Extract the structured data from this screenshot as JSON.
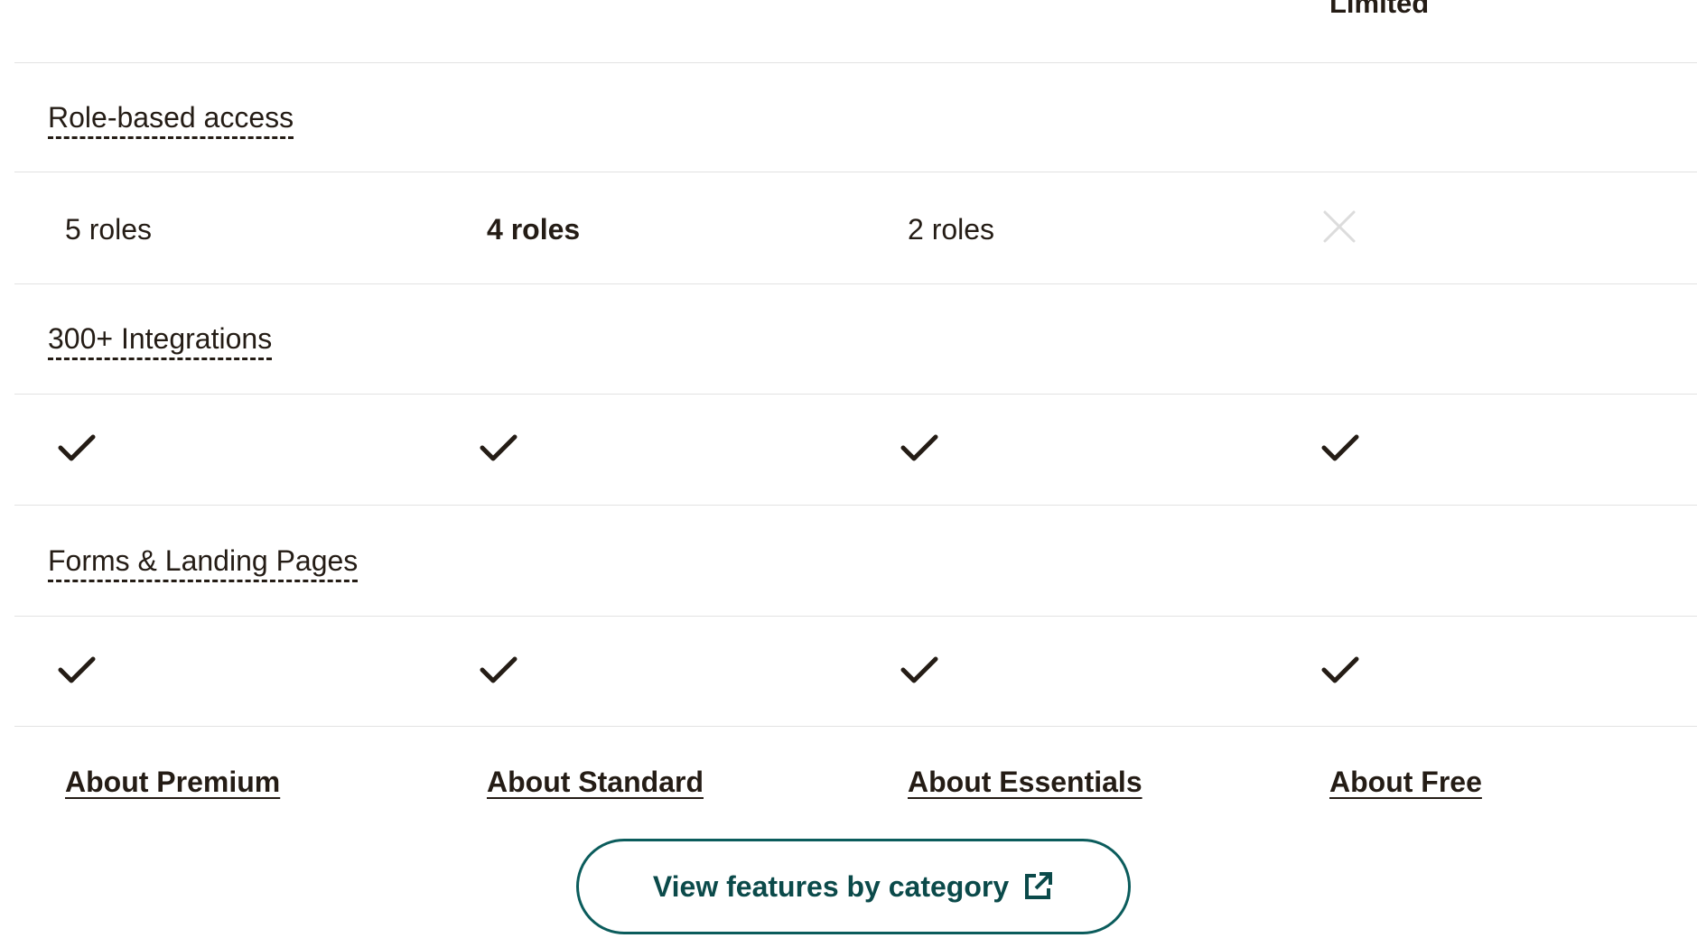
{
  "partial_row": {
    "free_value": "Limited"
  },
  "plans": [
    "Premium",
    "Standard",
    "Essentials",
    "Free"
  ],
  "features": [
    {
      "label": "Role-based access",
      "values": [
        "5 roles",
        "4 roles",
        "2 roles",
        "not-included"
      ]
    },
    {
      "label": "300+ Integrations",
      "values": [
        "included",
        "included",
        "included",
        "included"
      ]
    },
    {
      "label": "Forms & Landing Pages",
      "values": [
        "included",
        "included",
        "included",
        "included"
      ]
    }
  ],
  "about_links": {
    "premium": "About Premium",
    "standard": "About Standard",
    "essentials": "About Essentials",
    "free": "About Free"
  },
  "cta": {
    "label": "View features by category",
    "icon": "external-link-icon"
  },
  "colors": {
    "text": "#241c15",
    "cta_border": "#0b5c5c",
    "divider": "#e2e2e2",
    "not_included_icon": "#dcdcdc"
  }
}
